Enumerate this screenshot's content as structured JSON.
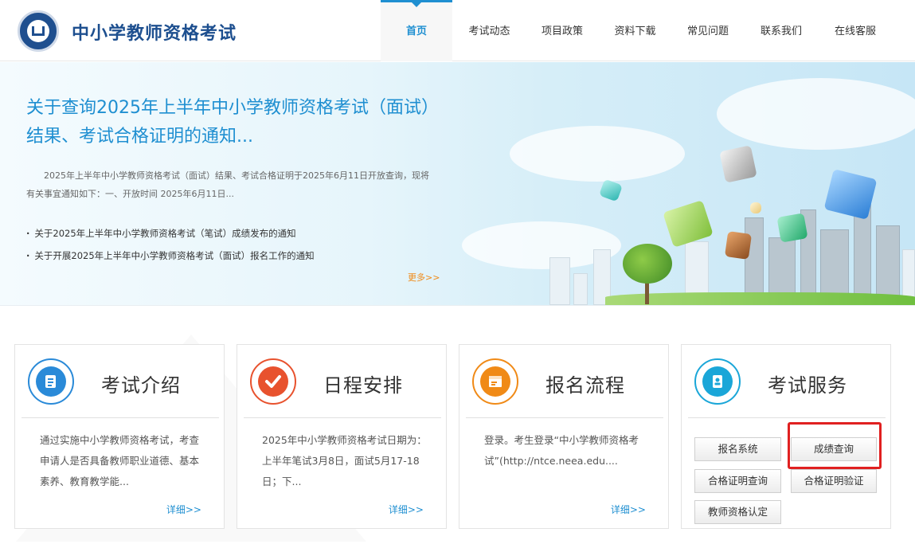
{
  "site": {
    "title": "中小学教师资格考试"
  },
  "nav": {
    "items": [
      {
        "label": "首页",
        "active": true
      },
      {
        "label": "考试动态"
      },
      {
        "label": "项目政策"
      },
      {
        "label": "资料下载"
      },
      {
        "label": "常见问题"
      },
      {
        "label": "联系我们"
      },
      {
        "label": "在线客服"
      }
    ]
  },
  "banner": {
    "title": "关于查询2025年上半年中小学教师资格考试（面试）结果、考试合格证明的通知...",
    "summary": "2025年上半年中小学教师资格考试（面试）结果、考试合格证明于2025年6月11日开放查询，现将有关事宜通知如下：一、开放时间   2025年6月11日...",
    "news": [
      "关于2025年上半年中小学教师资格考试（笔试）成绩发布的通知",
      "关于开展2025年上半年中小学教师资格考试（面试）报名工作的通知"
    ],
    "more": "更多>>"
  },
  "cards": [
    {
      "title": "考试介绍",
      "text": "通过实施中小学教师资格考试，考查申请人是否具备教师职业道德、基本素养、教育教学能...",
      "link": "详细>>",
      "color": "#2a8ad8"
    },
    {
      "title": "日程安排",
      "text": "2025年中小学教师资格考试日期为：上半年笔试3月8日，面试5月17-18日；下...",
      "link": "详细>>",
      "color": "#e8522e"
    },
    {
      "title": "报名流程",
      "text": "登录。考生登录“中小学教师资格考试”(http://ntce.neea.edu....",
      "link": "详细>>",
      "color": "#f08a17"
    },
    {
      "title": "考试服务",
      "color": "#1aa6d8"
    }
  ],
  "services": {
    "registration": "报名系统",
    "score_query": "成绩查询",
    "cert_query": "合格证明查询",
    "cert_verify": "合格证明验证",
    "qualification": "教师资格认定"
  },
  "colors": {
    "brand": "#1d4f8f",
    "accent": "#1f8fd1",
    "more": "#f08a17",
    "highlight": "#e02020"
  }
}
